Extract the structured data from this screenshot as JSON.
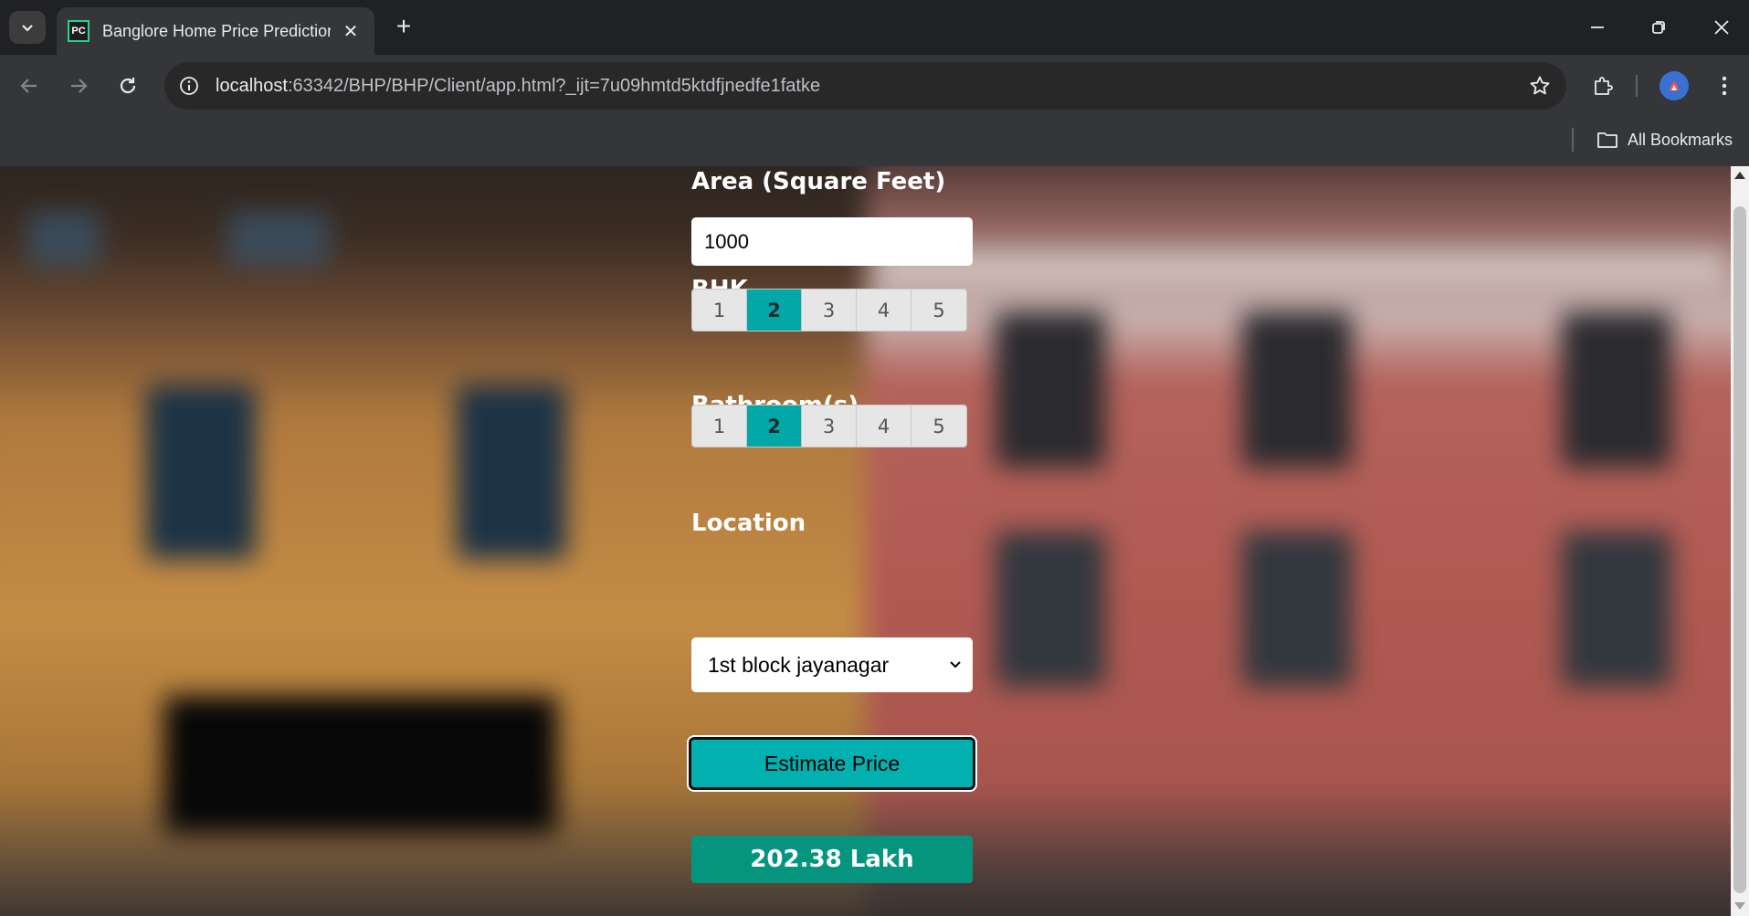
{
  "browser": {
    "tab_title": "Banglore Home Price Prediction",
    "favicon_text": "PC",
    "url_host": "localhost",
    "url_path": ":63342/BHP/BHP/Client/app.html?_ijt=7u09hmtd5ktdfjnedfe1fatke",
    "bookmarks_label": "All Bookmarks",
    "icons": [
      "tab-search-icon",
      "close-icon",
      "plus-icon",
      "minimize-icon",
      "restore-icon",
      "window-close-icon",
      "back-icon",
      "forward-icon",
      "reload-icon",
      "site-info-icon",
      "star-icon",
      "extensions-icon",
      "profile-icon",
      "kebab-menu-icon",
      "folder-icon"
    ]
  },
  "form": {
    "area_label": "Area (Square Feet)",
    "area_value": "1000",
    "bhk_label": "BHK",
    "bhk_options": [
      "1",
      "2",
      "3",
      "4",
      "5"
    ],
    "bhk_selected": "2",
    "bath_label": "Bathroom(s)",
    "bath_options": [
      "1",
      "2",
      "3",
      "4",
      "5"
    ],
    "bath_selected": "2",
    "location_label": "Location",
    "location_value": "1st block jayanagar",
    "estimate_button": "Estimate Price",
    "result": "202.38 Lakh"
  },
  "colors": {
    "accent_teal": "#02a8a8",
    "result_green": "#05957f"
  }
}
